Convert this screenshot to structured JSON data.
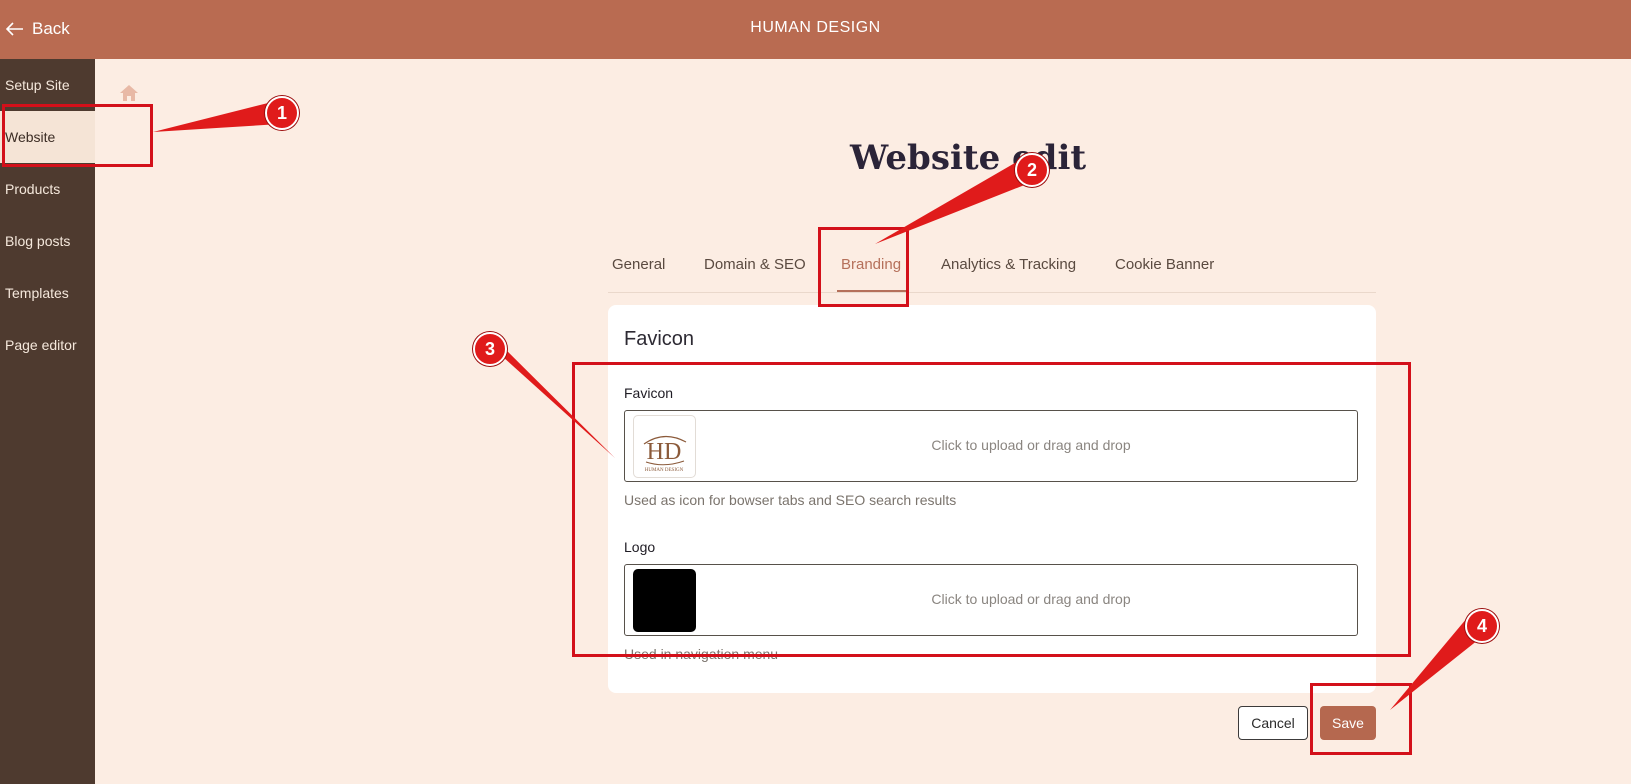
{
  "header": {
    "back_label": "Back",
    "app_title": "HUMAN DESIGN"
  },
  "sidebar": {
    "items": [
      {
        "label": "Setup Site"
      },
      {
        "label": "Website"
      },
      {
        "label": "Products"
      },
      {
        "label": "Blog posts"
      },
      {
        "label": "Templates"
      },
      {
        "label": "Page editor"
      }
    ],
    "active": "Website"
  },
  "page": {
    "title": "Website edit"
  },
  "tabs": [
    "General",
    "Domain & SEO",
    "Branding",
    "Analytics & Tracking",
    "Cookie Banner"
  ],
  "active_tab": "Branding",
  "favicon_section": {
    "title": "Favicon",
    "favicon": {
      "label": "Favicon",
      "upload_text": "Click to upload or drag and drop",
      "help": "Used as icon for bowser tabs and SEO search results",
      "logo_mark": "HD",
      "logo_caption": "HUMAN DESIGN"
    },
    "logo": {
      "label": "Logo",
      "upload_text": "Click to upload or drag and drop",
      "help": "Used in navigation menu"
    }
  },
  "actions": {
    "cancel": "Cancel",
    "save": "Save"
  },
  "annotations": [
    "1",
    "2",
    "3",
    "4"
  ],
  "colors": {
    "accent": "#b96b51",
    "sidebar": "#4e3a2f",
    "background": "#fcede3",
    "annotation": "#d3101a"
  }
}
